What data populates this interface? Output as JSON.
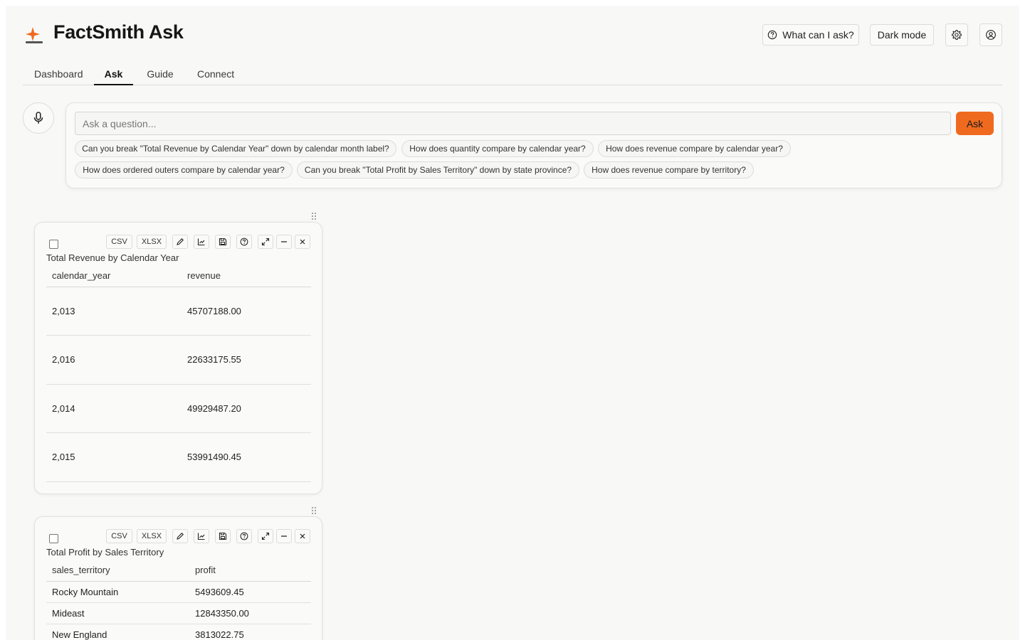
{
  "header": {
    "app_title": "FactSmith Ask",
    "help_label": "What can I ask?",
    "dark_mode_label": "Dark mode",
    "brand_color": "#ef6a1f"
  },
  "tabs": [
    {
      "label": "Dashboard"
    },
    {
      "label": "Ask",
      "active": true
    },
    {
      "label": "Guide"
    },
    {
      "label": "Connect"
    }
  ],
  "ask": {
    "placeholder": "Ask a question...",
    "value": "",
    "button_label": "Ask",
    "suggestions": [
      "Can you break \"Total Revenue by Calendar Year\" down by calendar month label?",
      "How does quantity compare by calendar year?",
      "How does revenue compare by calendar year?",
      "How does ordered outers compare by calendar year?",
      "Can you break \"Total Profit by Sales Territory\" down by state province?",
      "How does revenue compare by territory?"
    ]
  },
  "cards": [
    {
      "title": "Total Revenue by Calendar Year",
      "toolbar": {
        "csv": "CSV",
        "xlsx": "XLSX"
      },
      "columns": [
        "calendar_year",
        "revenue"
      ],
      "rows": [
        [
          "2,013",
          "45707188.00"
        ],
        [
          "2,016",
          "22633175.55"
        ],
        [
          "2,014",
          "49929487.20"
        ],
        [
          "2,015",
          "53991490.45"
        ]
      ]
    },
    {
      "title": "Total Profit by Sales Territory",
      "toolbar": {
        "csv": "CSV",
        "xlsx": "XLSX"
      },
      "columns": [
        "sales_territory",
        "profit"
      ],
      "rows": [
        [
          "Rocky Mountain",
          "5493609.45"
        ],
        [
          "Mideast",
          "12843350.00"
        ],
        [
          "New England",
          "3813022.75"
        ]
      ]
    }
  ],
  "icons": {
    "toolbar": [
      "pencil-icon",
      "chart-icon",
      "save-icon",
      "help-circle-icon",
      "expand-icon",
      "minimize-icon",
      "close-icon"
    ],
    "header": [
      "help-circle-icon",
      "gear-icon",
      "user-icon"
    ],
    "ask": [
      "microphone-icon"
    ]
  }
}
